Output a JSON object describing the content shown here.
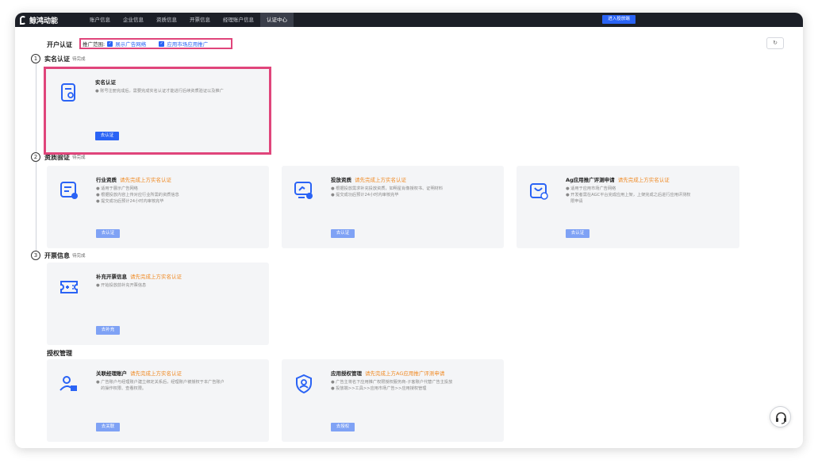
{
  "nav": {
    "logo": "鲸鸿动能",
    "items": [
      "账户信息",
      "企业信息",
      "资质信息",
      "开票信息",
      "经理账户信息",
      "认证中心"
    ],
    "active_index": 5,
    "enter_button": "进入投放端"
  },
  "page": {
    "title": "开户认证",
    "scope_label": "推广范围:",
    "scope_options": [
      "展示广告网络",
      "应用市场应用推广"
    ],
    "refresh_icon": "refresh-icon"
  },
  "steps": [
    {
      "num": "1",
      "title": "实名认证",
      "status": "待完成"
    },
    {
      "num": "2",
      "title": "资质验证",
      "status": "待完成"
    },
    {
      "num": "3",
      "title": "开票信息",
      "status": "待完成"
    }
  ],
  "cards": {
    "realname": {
      "title": "实名认证",
      "warn": "",
      "desc": [
        "● 账号注册完成后，需要完成实名认证才能进行后续资质验证以及推广"
      ],
      "button": "去认证"
    },
    "industry": {
      "title": "行业资质",
      "warn": "请先完成上方实名认证",
      "desc": [
        "● 适用于展示广告网络",
        "● 根据投放内容上传对应行业所需的资质信息",
        "● 提交成功后预计24小时内审核完毕"
      ],
      "button": "去认证"
    },
    "ads": {
      "title": "投放资质",
      "warn": "请先完成上方实名认证",
      "desc": [
        "● 根据投放需求补充投放资质，如明星肖像授权书、证明材料",
        "● 提交成功后预计24小时内审核完毕"
      ],
      "button": "去认证"
    },
    "ag": {
      "title": "Ag应用推广评测申请",
      "warn": "请先完成上方实名认证",
      "desc": [
        "● 适用于应用市场广告网络",
        "● 开发者需在AGC平台完成应用上架，上架完成之后进行应用评测权",
        "限申请"
      ],
      "button": "去认证"
    },
    "invoice": {
      "title": "补充开票信息",
      "warn": "请先完成上方实名认证",
      "desc": [
        "● 开始投放前补充开票信息"
      ],
      "button": "去补充"
    },
    "manager": {
      "title": "关联经理账户",
      "warn": "请先完成上方实名认证",
      "desc": [
        "● 广告账户与经理账户建立绑定关系后，经理账户被授权于本广告账户",
        "的操作权限、查看权限。"
      ],
      "button": "去关联"
    },
    "appauth": {
      "title": "应用授权管理",
      "warn": "请先完成上方AG应用推广评测申请",
      "desc": [
        "● 广告主将名下应用推广权限授权服务商-子客账户代替广告主投放",
        "● 投放端>>工具>>应用市场广告>>应用授权管理"
      ],
      "button": "去授权"
    }
  },
  "sections": {
    "auth": "授权管理"
  },
  "colors": {
    "accent": "#2a63f5",
    "warn": "#f08a24",
    "highlight": "#e0457b",
    "nav_bg": "#1c1f27"
  }
}
